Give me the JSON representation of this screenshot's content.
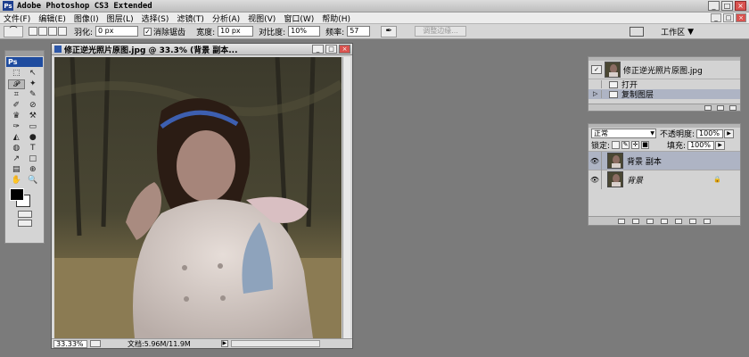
{
  "app": {
    "logo": "Ps",
    "title": "Adobe Photoshop CS3 Extended",
    "window_buttons": [
      "_",
      "□",
      "×"
    ]
  },
  "menu": {
    "items": [
      "文件(F)",
      "编辑(E)",
      "图像(I)",
      "图层(L)",
      "选择(S)",
      "滤镜(T)",
      "分析(A)",
      "视图(V)",
      "窗口(W)",
      "帮助(H)"
    ],
    "doc_buttons": [
      "_",
      "□",
      "×"
    ]
  },
  "options": {
    "feather_label": "羽化:",
    "feather_value": "0 px",
    "antialias_label": "消除锯齿",
    "antialias_checked": "✓",
    "width_label": "宽度:",
    "width_value": "10 px",
    "contrast_label": "对比度:",
    "contrast_value": "10%",
    "frequency_label": "频率:",
    "frequency_value": "57",
    "refine_edge": "调整边缘...",
    "workspace": "工作区",
    "workspace_arrow": "▼"
  },
  "tools": {
    "badge": "Ps",
    "glyphs": [
      "⬚",
      "↖",
      "𝓟",
      "✦",
      "⌗",
      "✎",
      "✐",
      "⊘",
      "♛",
      "⚒",
      "✑",
      "▭",
      "◭",
      "●",
      "◍",
      "T",
      "↗",
      "□",
      "▤",
      "⊕",
      "✋",
      "🔍"
    ]
  },
  "document": {
    "title": "修正逆光照片原图.jpg @ 33.3% (背景 副本...",
    "zoom": "33.33%",
    "doc_info": "文档:5.96M/11.9M",
    "scroll_arrow": "▶"
  },
  "history": {
    "snapshot_name": "修正逆光照片原图.jpg",
    "snapshot_icon": "✓",
    "steps": [
      {
        "label": "打开",
        "selected": false,
        "marker": ""
      },
      {
        "label": "复制图层",
        "selected": true,
        "marker": "▷"
      }
    ]
  },
  "layers": {
    "blend_mode": "正常",
    "opacity_label": "不透明度:",
    "opacity_value": "100%",
    "lock_label": "锁定:",
    "fill_label": "填充:",
    "fill_value": "100%",
    "visibility_glyph": "👁",
    "items": [
      {
        "name": "背景 副本",
        "selected": true
      },
      {
        "name": "背景",
        "selected": false,
        "locked": true
      }
    ],
    "footer_icons": [
      "link-icon",
      "fx-icon",
      "mask-icon",
      "adjustment-icon",
      "group-icon",
      "new-layer-icon",
      "trash-icon"
    ]
  }
}
